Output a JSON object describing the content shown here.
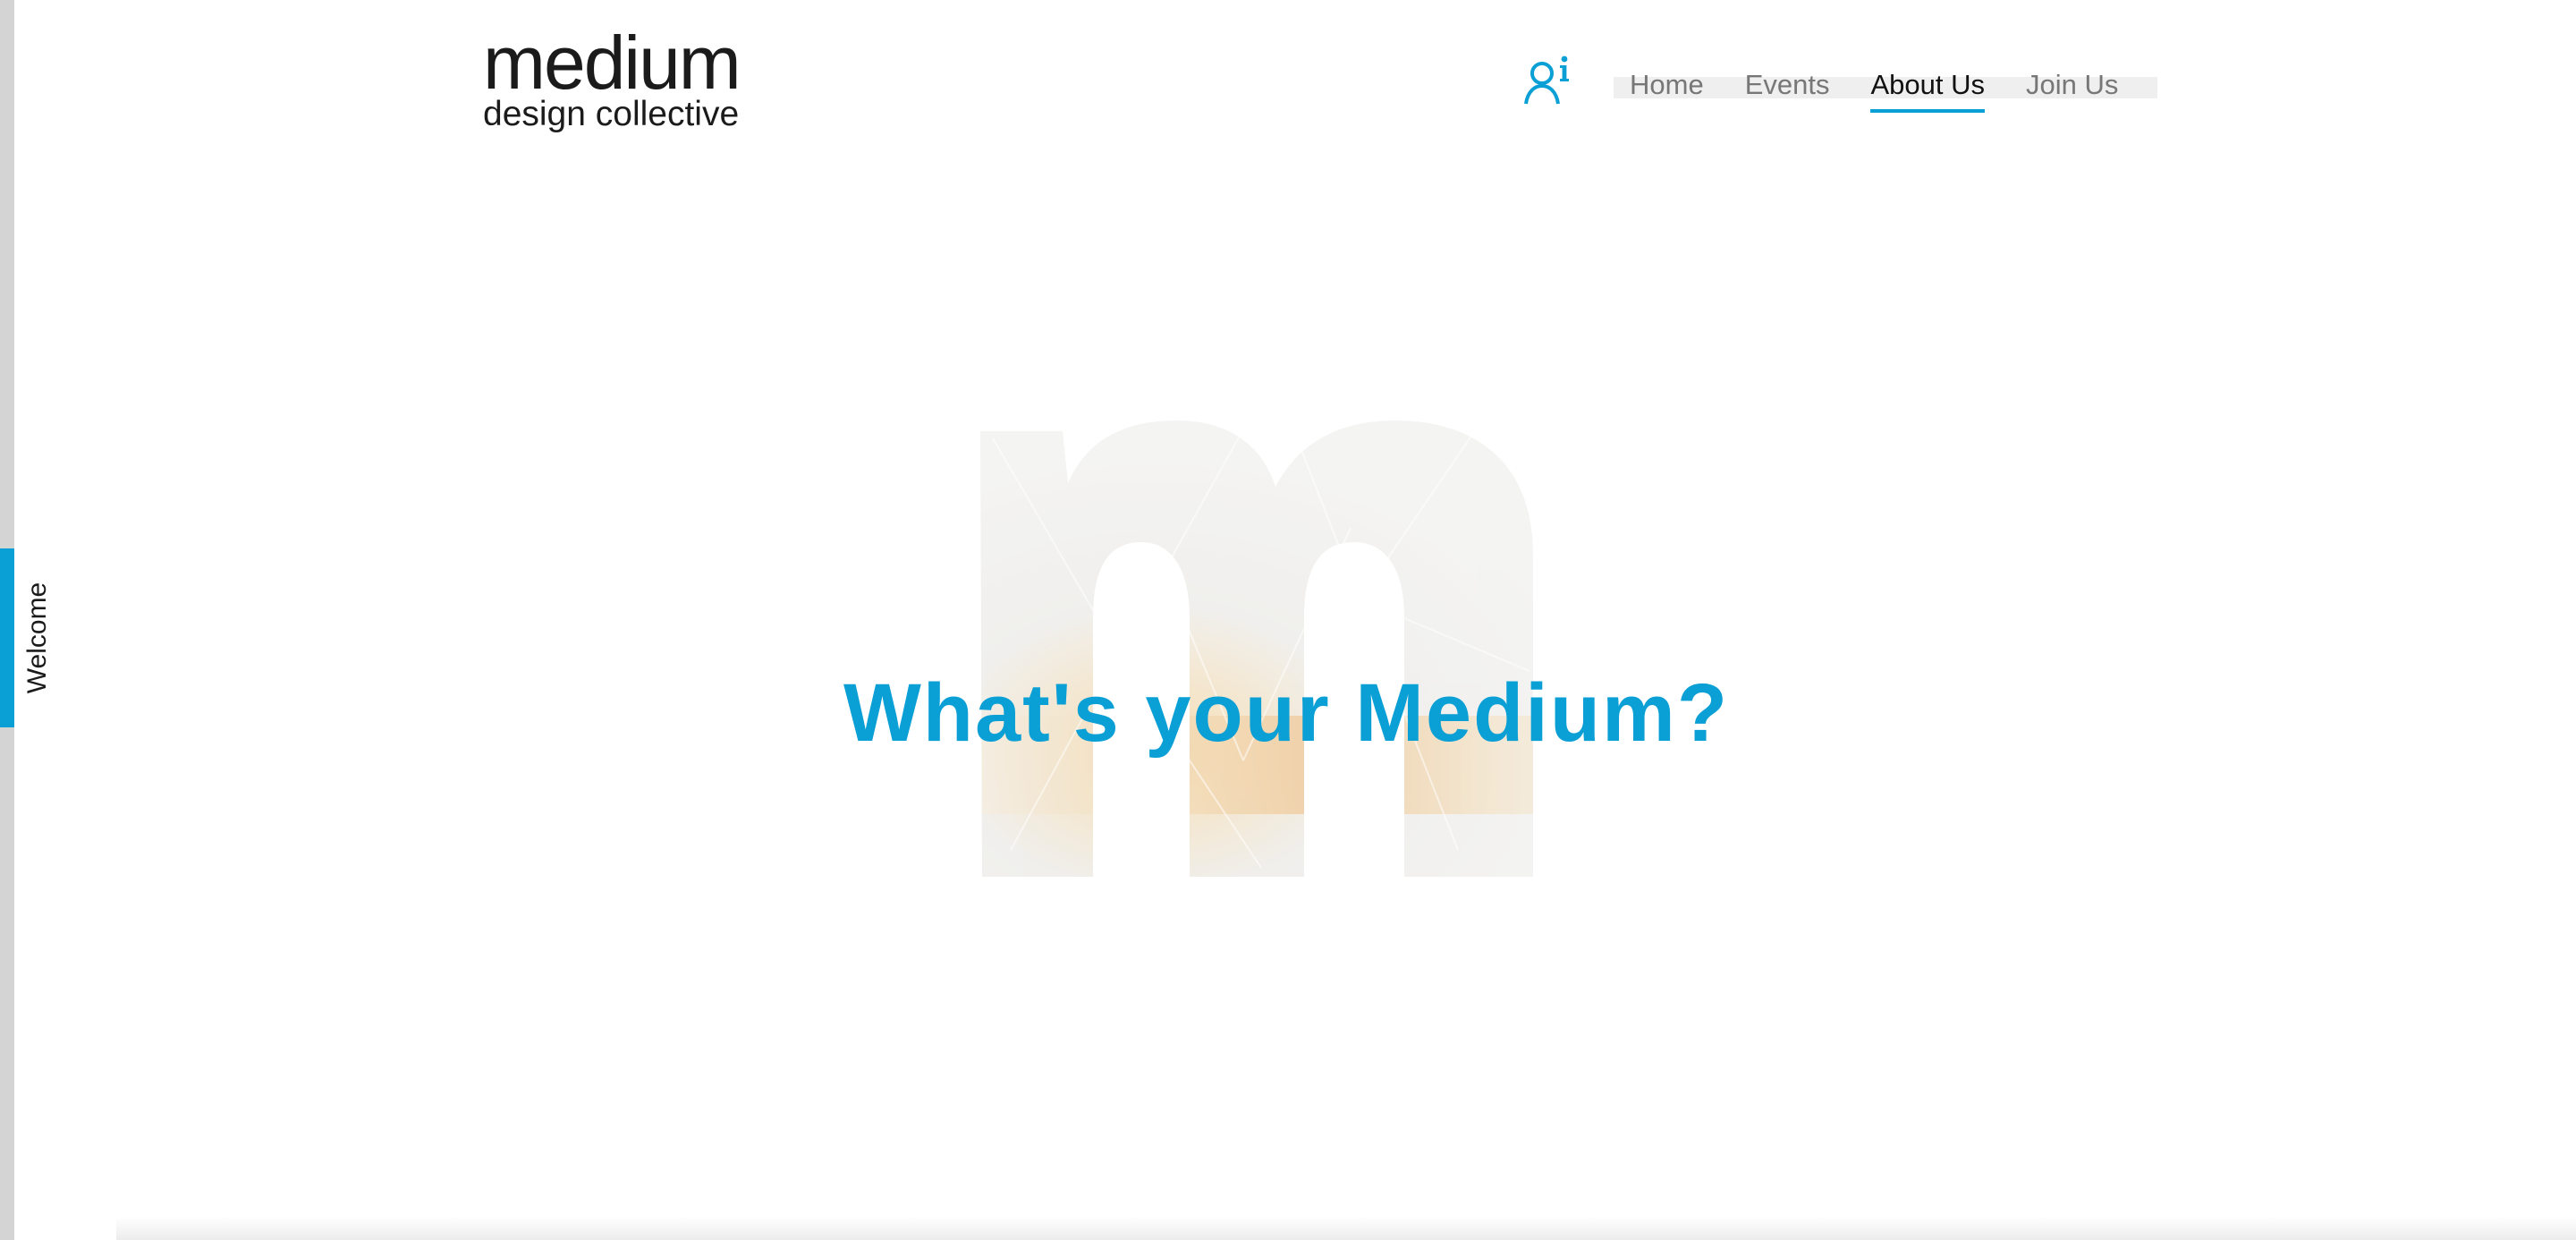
{
  "logo": {
    "word": "medium",
    "tagline": "design collective"
  },
  "header": {
    "account_icon": "user-info-icon",
    "nav": {
      "items": [
        {
          "label": "Home",
          "active": false
        },
        {
          "label": "Events",
          "active": false
        },
        {
          "label": "About Us",
          "active": true
        },
        {
          "label": "Join Us",
          "active": false
        }
      ]
    }
  },
  "side_tab": {
    "label": "Welcome"
  },
  "hero": {
    "title": "What's your Medium?",
    "background_glyph": "m"
  },
  "colors": {
    "accent": "#0aa0d6",
    "text": "#1b1b1b",
    "nav_inactive": "#777777",
    "rail": "#d4d4d4"
  }
}
